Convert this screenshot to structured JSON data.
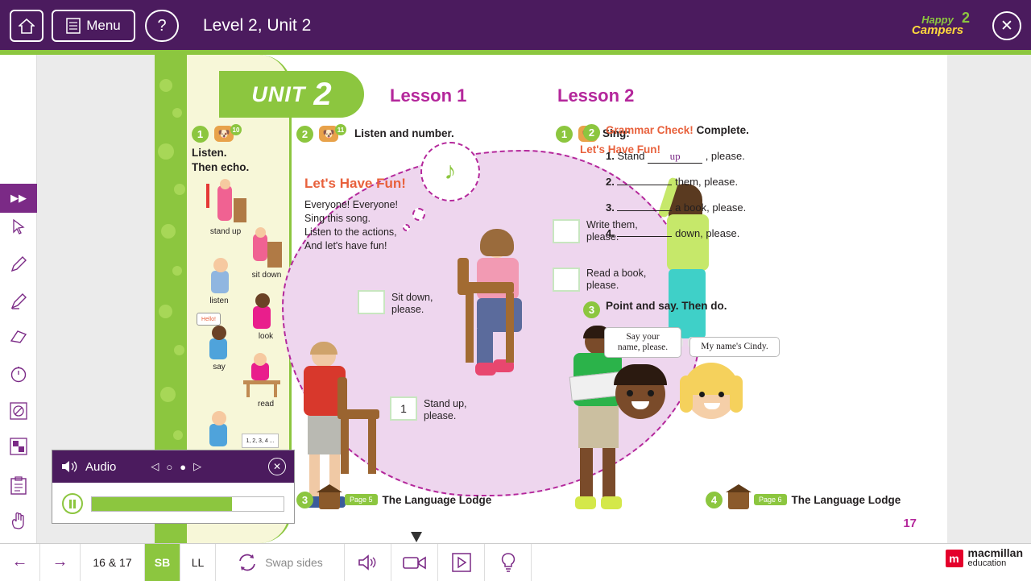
{
  "topbar": {
    "home_icon": "home-icon",
    "menu_label": "Menu",
    "help_label": "?",
    "title": "Level 2, Unit 2",
    "logo_happy": "Happy",
    "logo_campers": "Campers",
    "logo_level": "2",
    "close_label": "✕"
  },
  "left_toolbar": [
    {
      "name": "fast-forward-tool",
      "glyph": "▶▶"
    },
    {
      "name": "cursor-tool",
      "glyph": "➤"
    },
    {
      "name": "pen-tool",
      "glyph": "✎"
    },
    {
      "name": "highlighter-tool",
      "glyph": "✒"
    },
    {
      "name": "eraser-tool",
      "glyph": "▱"
    },
    {
      "name": "timer-tool",
      "glyph": "◴"
    },
    {
      "name": "shape-tool",
      "glyph": "◎"
    },
    {
      "name": "grid-tool",
      "glyph": "▦"
    },
    {
      "name": "notes-tool",
      "glyph": "Ὄb"
    },
    {
      "name": "hand-tool",
      "glyph": "✋"
    }
  ],
  "page": {
    "unit_word": "UNIT",
    "unit_number": "2",
    "lesson1": "Lesson 1",
    "lesson2": "Lesson 2",
    "page_number": "17",
    "ex1": {
      "number": "1",
      "track": "10",
      "instruction_line1": "Listen.",
      "instruction_line2": "Then echo.",
      "labels": [
        "stand up",
        "sit down",
        "listen",
        "look",
        "say",
        "read"
      ],
      "hello_bubble": "Hello!",
      "count_label": "1, 2, 3, 4 ..."
    },
    "ex2": {
      "number": "2",
      "track": "11",
      "instruction": "Listen and number.",
      "song_title": "Let's Have Fun!",
      "song_lines": [
        "Everyone! Everyone!",
        "Sing this song.",
        "Listen to the actions,",
        "And let's have fun!"
      ],
      "items": [
        {
          "box": "",
          "caption_line1": "Sit down,",
          "caption_line2": "please."
        },
        {
          "box": "1",
          "caption_line1": "Stand up,",
          "caption_line2": "please."
        },
        {
          "box": "",
          "caption_line1": "Write them,",
          "caption_line2": "please."
        },
        {
          "box": "",
          "caption_line1": "Read a book,",
          "caption_line2": "please."
        }
      ]
    },
    "ex3_lesson2": {
      "number": "1",
      "instruction": "Sing:",
      "song_title": "Let's Have Fun!"
    },
    "grammar_check": {
      "number": "2",
      "red_label": "Grammar Check!",
      "rest_label": "Complete.",
      "rows": [
        {
          "n": "1.",
          "pre": "Stand",
          "answer": "up",
          "post": ", please."
        },
        {
          "n": "2.",
          "pre": "",
          "answer": "",
          "post": "them, please."
        },
        {
          "n": "3.",
          "pre": "",
          "answer": "",
          "post": "a book, please."
        },
        {
          "n": "4.",
          "pre": "",
          "answer": "",
          "post": "down, please."
        }
      ]
    },
    "point_and_say": {
      "number": "3",
      "instruction": "Point and say. Then do.",
      "bubble1_line1": "Say your",
      "bubble1_line2": "name, please.",
      "bubble2": "My name's Cindy."
    },
    "lodge_left": {
      "number": "3",
      "page_label": "Page 5",
      "text": "The Language Lodge"
    },
    "lodge_right": {
      "number": "4",
      "page_label": "Page 6",
      "text": "The Language Lodge"
    }
  },
  "audio_panel": {
    "title": "Audio",
    "speaker_icon": "speaker-icon",
    "prev_icon": "◁",
    "stop_icon": "○",
    "rec_icon": "●",
    "next_icon": "▷",
    "close_icon": "✕",
    "progress_percent": 73
  },
  "bottombar": {
    "back_icon": "←",
    "forward_icon": "→",
    "pages_label": "16 & 17",
    "sb_label": "SB",
    "ll_label": "LL",
    "swap_label": "Swap sides",
    "audio_icon": "speaker-icon",
    "video_icon": "video-camera-icon",
    "play_icon": "play-icon",
    "idea_icon": "lightbulb-icon",
    "brand_line1": "macmillan",
    "brand_line2": "education"
  },
  "colors": {
    "purple": "#4b1b5e",
    "green": "#8cc63f",
    "magenta": "#b4279b",
    "orange": "#e8613c"
  }
}
